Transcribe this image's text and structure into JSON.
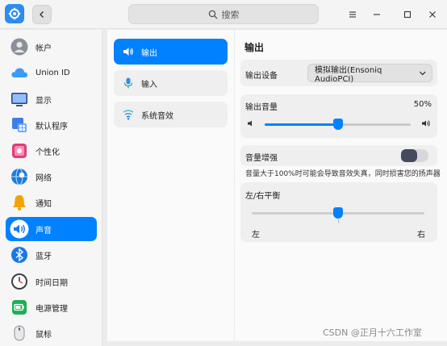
{
  "header": {
    "search_placeholder": "搜索"
  },
  "sidebar": {
    "items": [
      {
        "label": "帐户",
        "icon": "account-avatar-icon"
      },
      {
        "label": "Union ID",
        "icon": "cloud-icon"
      },
      {
        "label": "显示",
        "icon": "display-icon"
      },
      {
        "label": "默认程序",
        "icon": "default-apps-icon"
      },
      {
        "label": "个性化",
        "icon": "personalization-icon"
      },
      {
        "label": "网络",
        "icon": "network-globe-icon"
      },
      {
        "label": "通知",
        "icon": "bell-icon"
      },
      {
        "label": "声音",
        "icon": "speaker-icon",
        "active": true
      },
      {
        "label": "蓝牙",
        "icon": "bluetooth-icon"
      },
      {
        "label": "时间日期",
        "icon": "clock-icon"
      },
      {
        "label": "电源管理",
        "icon": "battery-icon"
      },
      {
        "label": "鼠标",
        "icon": "mouse-icon"
      }
    ]
  },
  "sound_menu": {
    "items": [
      {
        "label": "输出",
        "icon": "speaker-output-icon",
        "active": true
      },
      {
        "label": "输入",
        "icon": "microphone-icon"
      },
      {
        "label": "系统音效",
        "icon": "system-sound-icon"
      }
    ]
  },
  "output": {
    "title": "输出",
    "device_label": "输出设备",
    "device_value": "模拟输出(Ensoniq AudioPCI)",
    "volume_label": "输出音量",
    "volume_percent": "50%",
    "volume_level": 0.5,
    "boost_label": "音量增强",
    "boost_enabled": false,
    "boost_hint": "音量大于100%时可能会导致音效失真，同时损害您的扬声器",
    "balance_label": "左/右平衡",
    "balance_left": "左",
    "balance_right": "右",
    "balance_level": 0.5
  },
  "watermark": "CSDN @正月十六工作室",
  "colors": {
    "accent": "#0081ff",
    "toggle_knob": "#454a5e"
  }
}
